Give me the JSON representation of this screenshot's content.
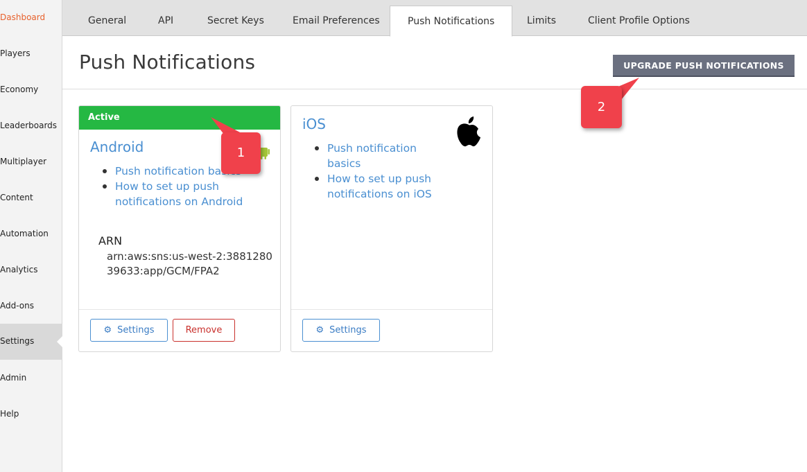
{
  "sidebar": {
    "items": [
      {
        "label": "Dashboard",
        "state": "highlight"
      },
      {
        "label": "Players"
      },
      {
        "label": "Economy"
      },
      {
        "label": "Leaderboards"
      },
      {
        "label": "Multiplayer"
      },
      {
        "label": "Content"
      },
      {
        "label": "Automation"
      },
      {
        "label": "Analytics"
      },
      {
        "label": "Add-ons"
      },
      {
        "label": "Settings",
        "state": "selected"
      },
      {
        "label": "Admin"
      },
      {
        "label": "Help"
      }
    ]
  },
  "tabs": [
    {
      "label": "General"
    },
    {
      "label": "API"
    },
    {
      "label": "Secret Keys"
    },
    {
      "label": "Email Preferences"
    },
    {
      "label": "Push Notifications",
      "active": true
    },
    {
      "label": "Limits"
    },
    {
      "label": "Client Profile Options"
    }
  ],
  "header": {
    "title": "Push Notifications",
    "upgrade_label": "UPGRADE PUSH NOTIFICATIONS"
  },
  "cards": {
    "android": {
      "status": "Active",
      "title": "Android",
      "icon": "android-icon",
      "links": [
        "Push notification basics",
        "How to set up push notifications on Android"
      ],
      "arn_label": "ARN",
      "arn_value": "arn:aws:sns:us-west-2:388128039633:app/GCM/FPA2",
      "settings_label": "Settings",
      "remove_label": "Remove"
    },
    "ios": {
      "title": "iOS",
      "icon": "apple-icon",
      "links": [
        "Push notification basics",
        "How to set up push notifications on iOS"
      ],
      "settings_label": "Settings"
    }
  },
  "callouts": [
    "1",
    "2"
  ],
  "colors": {
    "accent": "#4a8fd1",
    "active_green": "#25b843",
    "danger": "#c9302c",
    "highlight_orange": "#e8612c",
    "callout_red": "#f0414b",
    "upgrade_button": "#6b7080"
  }
}
